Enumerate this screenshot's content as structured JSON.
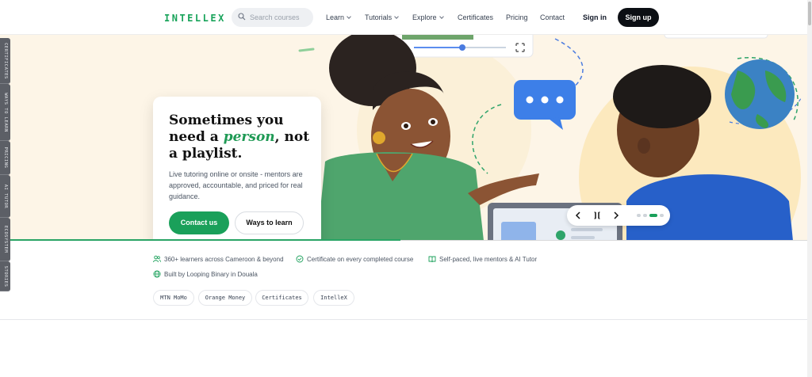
{
  "header": {
    "logo_text": "INTELLEX",
    "search_placeholder": "Search courses",
    "nav": [
      {
        "label": "Learn",
        "dropdown": true
      },
      {
        "label": "Tutorials",
        "dropdown": true
      },
      {
        "label": "Explore",
        "dropdown": true
      },
      {
        "label": "Certificates",
        "dropdown": false
      },
      {
        "label": "Pricing",
        "dropdown": false
      },
      {
        "label": "Contact",
        "dropdown": false
      }
    ],
    "signin_label": "Sign in",
    "signup_label": "Sign up"
  },
  "side_tabs": [
    "CERTIFICATES",
    "WAYS TO LEARN",
    "PRICING",
    "AI TUTOR",
    "ECOSYSTEM",
    "STORIES"
  ],
  "hero": {
    "title_part1": "Sometimes you need a ",
    "title_accent": "person",
    "title_part2": ", not a playlist.",
    "subtitle": "Live tutoring online or onsite - mentors are approved, accountable, and priced for real guidance.",
    "primary_button": "Contact us",
    "secondary_button": "Ways to learn"
  },
  "carousel": {
    "slide_count": 4,
    "active_slide": 3,
    "icons": [
      "chevron-left-icon",
      "pause-icon",
      "chevron-right-icon"
    ]
  },
  "features": [
    {
      "icon": "users-icon",
      "text": "360+ learners across Cameroon & beyond"
    },
    {
      "icon": "check-circle-icon",
      "text": "Certificate on every completed course"
    },
    {
      "icon": "book-icon",
      "text": "Self-paced, live mentors & AI Tutor"
    },
    {
      "icon": "globe-icon",
      "text": "Built by Looping Binary in Douala"
    }
  ],
  "tags": [
    "MTN MoMo",
    "Orange Money",
    "Certificates",
    "IntelleX"
  ],
  "colors": {
    "brand_green": "#1aa05a",
    "dark": "#0c0f14",
    "hero_bg": "#fdf5e7",
    "chat_bubble": "#3b82f6"
  }
}
